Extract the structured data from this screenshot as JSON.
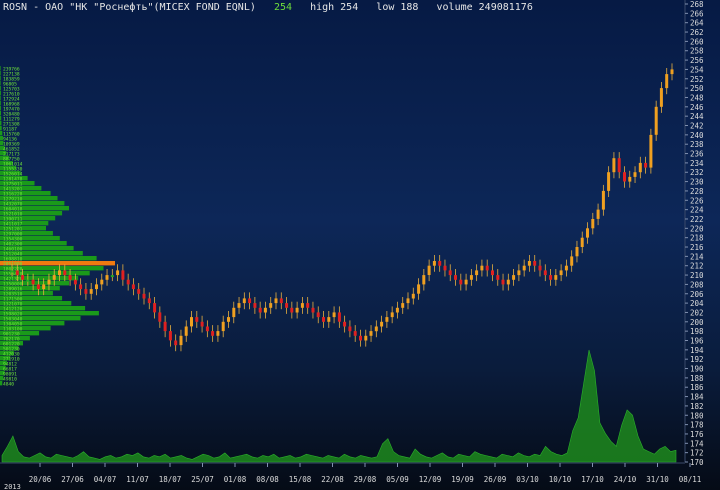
{
  "header": {
    "ticker": "ROSN - ОАО \"НК \"Роснефть\"(MICEX FOND EQNL)",
    "last": "254",
    "high": "high 254",
    "low": "low 188",
    "volume": "volume 249081176"
  },
  "colors": {
    "bg_top": "#061a44",
    "candle_up": "#f0a020",
    "candle_down": "#e02020",
    "candle_green": "#22aa22",
    "profile": "#1a9a1a",
    "profile_poc": "#f07a10",
    "volume_fill": "#1d8a1d",
    "axis_text": "#dcdcdc",
    "profile_labels": "#6fe63a"
  },
  "chart_data": {
    "type": "candlestick",
    "y_axis": {
      "min": 170,
      "max": 268,
      "ticks": [
        268,
        266,
        264,
        262,
        260,
        258,
        256,
        254,
        252,
        250,
        248,
        246,
        244,
        242,
        240,
        238,
        236,
        234,
        232,
        230,
        228,
        226,
        224,
        222,
        220,
        218,
        216,
        214,
        212,
        210,
        208,
        206,
        204,
        202,
        200,
        198,
        196,
        194,
        192,
        190,
        188,
        186,
        184,
        182,
        180,
        178,
        176,
        174,
        172,
        170
      ]
    },
    "x_axis": {
      "labels": [
        "20/06",
        "27/06",
        "04/07",
        "11/07",
        "18/07",
        "25/07",
        "01/08",
        "08/08",
        "15/08",
        "22/08",
        "29/08",
        "05/09",
        "12/09",
        "19/09",
        "26/09",
        "03/10",
        "10/10",
        "17/10",
        "24/10",
        "31/10",
        "08/11"
      ]
    },
    "x_axis_sub_label": "2013",
    "price_closes": [
      211,
      210,
      209,
      209,
      208,
      207,
      208,
      209,
      210,
      211,
      210,
      209,
      208,
      207,
      206,
      207,
      208,
      209,
      210,
      210,
      211,
      209,
      208,
      207,
      206,
      205,
      204,
      202,
      200,
      198,
      196,
      195,
      197,
      199,
      201,
      200,
      199,
      198,
      197,
      198,
      200,
      201,
      203,
      204,
      205,
      204,
      203,
      202,
      203,
      204,
      205,
      204,
      203,
      202,
      203,
      204,
      203,
      202,
      201,
      200,
      201,
      202,
      200,
      199,
      198,
      197,
      196,
      197,
      198,
      199,
      200,
      201,
      202,
      203,
      204,
      205,
      206,
      208,
      210,
      212,
      213,
      212,
      211,
      210,
      209,
      208,
      209,
      210,
      211,
      212,
      211,
      210,
      209,
      208,
      209,
      210,
      211,
      212,
      213,
      212,
      211,
      210,
      209,
      210,
      211,
      212,
      214,
      216,
      218,
      220,
      222,
      224,
      228,
      232,
      235,
      232,
      230,
      231,
      232,
      234,
      233,
      240,
      246,
      250,
      253,
      254
    ],
    "volume_series": [
      5,
      12,
      20,
      8,
      4,
      3,
      5,
      7,
      4,
      3,
      6,
      5,
      4,
      3,
      5,
      8,
      4,
      3,
      2,
      4,
      5,
      3,
      4,
      6,
      5,
      7,
      4,
      3,
      5,
      4,
      6,
      3,
      4,
      5,
      3,
      2,
      4,
      6,
      5,
      3,
      4,
      7,
      3,
      4,
      5,
      6,
      4,
      3,
      5,
      4,
      6,
      3,
      4,
      5,
      3,
      4,
      6,
      5,
      4,
      3,
      5,
      4,
      3,
      6,
      4,
      3,
      5,
      4,
      3,
      4,
      14,
      18,
      8,
      5,
      4,
      3,
      10,
      6,
      4,
      3,
      5,
      7,
      4,
      3,
      6,
      5,
      4,
      8,
      6,
      5,
      4,
      3,
      6,
      5,
      4,
      7,
      5,
      4,
      6,
      5,
      12,
      8,
      6,
      5,
      7,
      24,
      34,
      60,
      86,
      70,
      30,
      22,
      16,
      12,
      28,
      40,
      36,
      20,
      10,
      8,
      6,
      10,
      12,
      8,
      9
    ],
    "volume_profile": [
      {
        "label": "239766",
        "value": 0.5
      },
      {
        "label": "227138",
        "value": 0.6
      },
      {
        "label": "183859",
        "value": 0.6
      },
      {
        "label": "96805",
        "value": 0.5
      },
      {
        "label": "125703",
        "value": 0.7
      },
      {
        "label": "217610",
        "value": 0.8
      },
      {
        "label": "172924",
        "value": 0.6
      },
      {
        "label": "168968",
        "value": 0.7
      },
      {
        "label": "197470",
        "value": 0.8
      },
      {
        "label": "320480",
        "value": 0.9
      },
      {
        "label": "111279",
        "value": 1.0
      },
      {
        "label": "271308",
        "value": 1.2
      },
      {
        "label": "91187",
        "value": 1.5
      },
      {
        "label": "115760",
        "value": 2.0
      },
      {
        "label": "94136",
        "value": 2.6
      },
      {
        "label": "109369",
        "value": 3.0
      },
      {
        "label": "461852",
        "value": 4.0
      },
      {
        "label": "217173",
        "value": 5.5
      },
      {
        "label": "887750",
        "value": 8
      },
      {
        "label": "1061014",
        "value": 11
      },
      {
        "label": "1155330",
        "value": 14
      },
      {
        "label": "1526014",
        "value": 18
      },
      {
        "label": "1281478",
        "value": 24
      },
      {
        "label": "1375011",
        "value": 30
      },
      {
        "label": "1413201",
        "value": 36
      },
      {
        "label": "1316228",
        "value": 44
      },
      {
        "label": "1279210",
        "value": 50
      },
      {
        "label": "1432070",
        "value": 56
      },
      {
        "label": "1604018",
        "value": 60
      },
      {
        "label": "1521010",
        "value": 54
      },
      {
        "label": "1390711",
        "value": 48
      },
      {
        "label": "1411017",
        "value": 42
      },
      {
        "label": "1251201",
        "value": 40
      },
      {
        "label": "1297000",
        "value": 46
      },
      {
        "label": "1354300",
        "value": 52
      },
      {
        "label": "1402300",
        "value": 58
      },
      {
        "label": "1460100",
        "value": 64
      },
      {
        "label": "1512040",
        "value": 72
      },
      {
        "label": "1698810",
        "value": 84
      },
      {
        "label": "2051090",
        "value": 100,
        "poc": true
      },
      {
        "label": "1802220",
        "value": 90
      },
      {
        "label": "1550410",
        "value": 78
      },
      {
        "label": "1421320",
        "value": 68
      },
      {
        "label": "1350000",
        "value": 60
      },
      {
        "label": "1289016",
        "value": 52
      },
      {
        "label": "1203510",
        "value": 46
      },
      {
        "label": "1171500",
        "value": 54
      },
      {
        "label": "1321070",
        "value": 62
      },
      {
        "label": "1412120",
        "value": 74
      },
      {
        "label": "1598020",
        "value": 86
      },
      {
        "label": "1503040",
        "value": 70
      },
      {
        "label": "1304050",
        "value": 56
      },
      {
        "label": "1103100",
        "value": 44
      },
      {
        "label": "901230",
        "value": 34
      },
      {
        "label": "782170",
        "value": 26
      },
      {
        "label": "601220",
        "value": 20
      },
      {
        "label": "501230",
        "value": 16
      },
      {
        "label": "412030",
        "value": 12
      },
      {
        "label": "271910",
        "value": 9
      },
      {
        "label": "94812",
        "value": 6
      },
      {
        "label": "66817",
        "value": 5
      },
      {
        "label": "98091",
        "value": 4
      },
      {
        "label": "49810",
        "value": 3
      },
      {
        "label": "4840",
        "value": 2
      }
    ]
  }
}
